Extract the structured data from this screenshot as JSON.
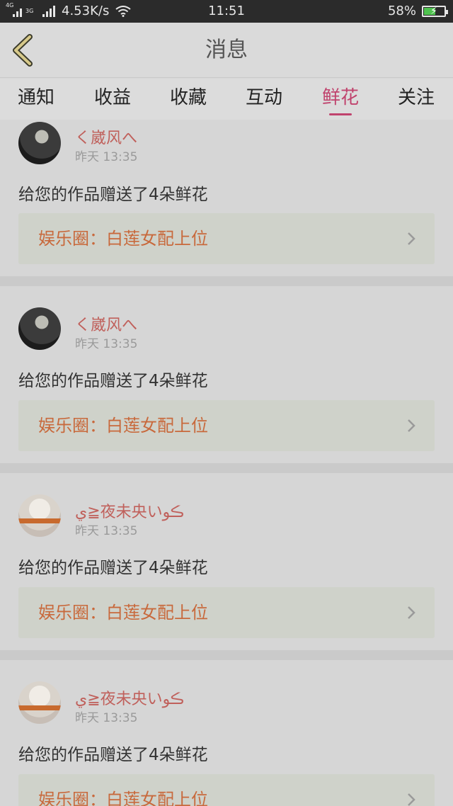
{
  "status_bar": {
    "network_small": "4G",
    "network_type": "3G",
    "net_speed": "4.53K/s",
    "time": "11:51",
    "battery_percent": "58%",
    "battery_level": 0.58,
    "wifi_icon": "wifi-icon",
    "battery_icon": "battery-charging-icon"
  },
  "header": {
    "title": "消息",
    "back_icon": "chevron-left-icon"
  },
  "tabs": [
    {
      "label": "通知",
      "active": false
    },
    {
      "label": "收益",
      "active": false
    },
    {
      "label": "收藏",
      "active": false
    },
    {
      "label": "互动",
      "active": false
    },
    {
      "label": "鲜花",
      "active": true
    },
    {
      "label": "关注",
      "active": false
    }
  ],
  "colors": {
    "accent": "#c0436d",
    "username": "#c0605b",
    "link_text": "#c8693c"
  },
  "messages": [
    {
      "user": "く崴风へ",
      "time": "昨天 13:35",
      "text": "给您的作品赠送了4朵鲜花",
      "link": "娱乐圈：白莲女配上位"
    },
    {
      "user": "く崴风へ",
      "time": "昨天 13:35",
      "text": "给您的作品赠送了4朵鲜花",
      "link": "娱乐圈：白莲女配上位"
    },
    {
      "user": "ي≧夜未央いڪو",
      "time": "昨天 13:35",
      "text": "给您的作品赠送了4朵鲜花",
      "link": "娱乐圈：白莲女配上位"
    },
    {
      "user": "ي≧夜未央いڪو",
      "time": "昨天 13:35",
      "text": "给您的作品赠送了4朵鲜花",
      "link": "娱乐圈：白莲女配上位"
    }
  ]
}
